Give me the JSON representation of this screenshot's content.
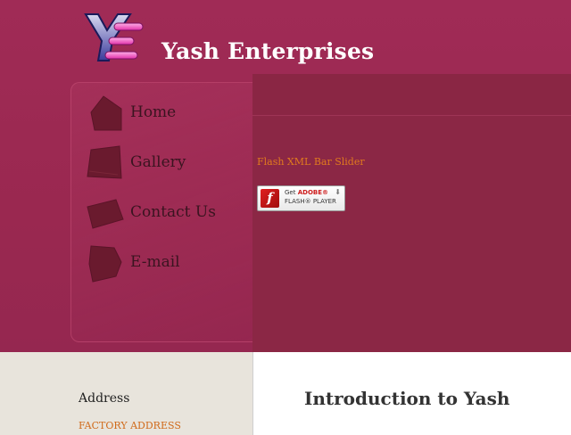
{
  "site": {
    "title": "Yash Enterprises",
    "logo_icon": "ye-monogram-logo"
  },
  "nav": {
    "items": [
      {
        "label": "Home",
        "icon": "house-icon"
      },
      {
        "label": "Gallery",
        "icon": "gallery-icon"
      },
      {
        "label": "Contact Us",
        "icon": "contact-card-icon"
      },
      {
        "label": "E-mail",
        "icon": "mail-icon"
      }
    ]
  },
  "flash": {
    "slider_text": "Flash XML Bar Slider",
    "badge": {
      "get": "Get",
      "brand": "ADOBE",
      "product": "FLASH",
      "player": "PLAYER"
    }
  },
  "footer": {
    "address_heading": "Address",
    "factory_address": "FACTORY ADDRESS",
    "intro_title": "Introduction to Yash"
  },
  "colors": {
    "header_bg": "#9b2a52",
    "flash_bg": "#8b2745",
    "nav_text": "#3a1420",
    "link_orange": "#e07a1e",
    "footer_left_bg": "#e8e4dc",
    "footer_right_bg": "#ffffff"
  }
}
